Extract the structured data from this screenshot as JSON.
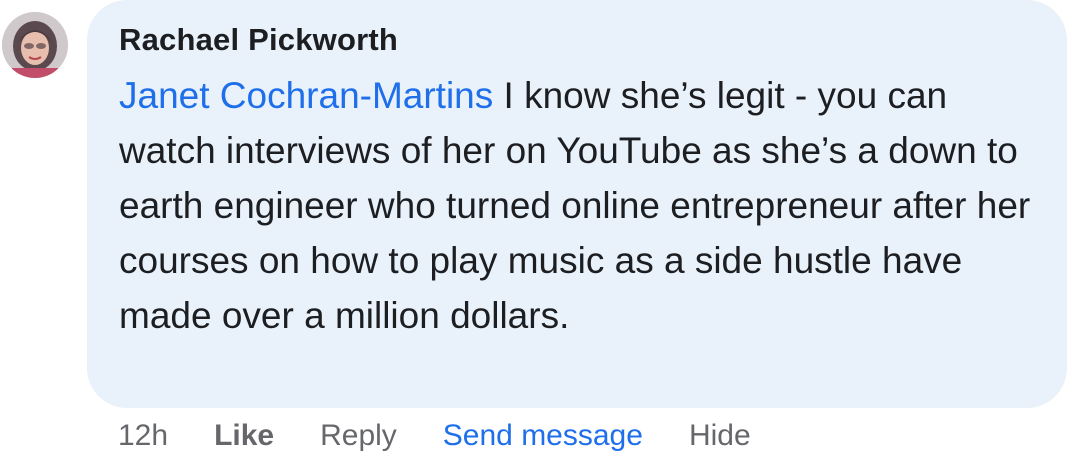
{
  "comment": {
    "author": "Rachael Pickworth",
    "mention": "Janet Cochran-Martins",
    "text": " I know she’s legit - you can watch interviews of her on YouTube as she’s a down to earth engineer who turned online entrepreneur after her courses on how to play music as a side hustle have made over a million dollars.",
    "avatar_icon": "profile-photo"
  },
  "actions": {
    "time": "12h",
    "like": "Like",
    "reply": "Reply",
    "send_message": "Send message",
    "hide": "Hide"
  },
  "colors": {
    "bubble": "#e9f1fb",
    "mention": "#1f6feb",
    "text": "#1c1e21",
    "muted": "#65676b"
  }
}
